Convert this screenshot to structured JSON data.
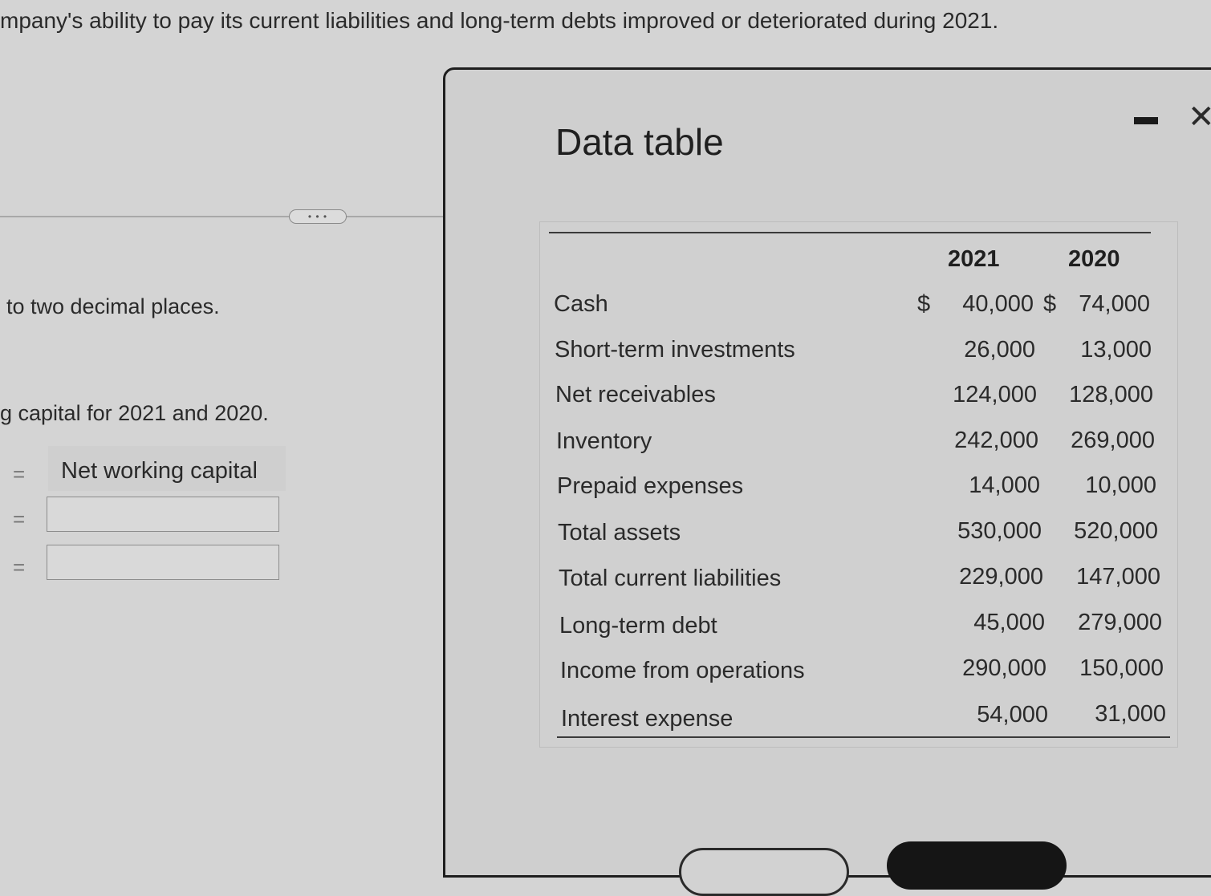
{
  "question": {
    "text": "mpany's ability to pay its current liabilities and long-term debts improved or deteriorated during 2021."
  },
  "more_button": {
    "label": "• • •"
  },
  "instructions": {
    "rounding": "to two decimal places.",
    "compute": "g capital for 2021 and 2020."
  },
  "formula": {
    "equals": "=",
    "result_label": "Net working capital"
  },
  "modal": {
    "title": "Data table",
    "minimize_icon": "minimize-icon",
    "close_icon": "close-icon",
    "close_glyph": "✕"
  },
  "data_table": {
    "columns": [
      "2021",
      "2020"
    ],
    "currency_symbol": "$",
    "rows": [
      {
        "label": "Cash",
        "v2021": "40,000",
        "v2020": "74,000"
      },
      {
        "label": "Short-term investments",
        "v2021": "26,000",
        "v2020": "13,000"
      },
      {
        "label": "Net receivables",
        "v2021": "124,000",
        "v2020": "128,000"
      },
      {
        "label": "Inventory",
        "v2021": "242,000",
        "v2020": "269,000"
      },
      {
        "label": "Prepaid expenses",
        "v2021": "14,000",
        "v2020": "10,000"
      },
      {
        "label": "Total assets",
        "v2021": "530,000",
        "v2020": "520,000"
      },
      {
        "label": "Total current liabilities",
        "v2021": "229,000",
        "v2020": "147,000"
      },
      {
        "label": "Long-term debt",
        "v2021": "45,000",
        "v2020": "279,000"
      },
      {
        "label": "Income from operations",
        "v2021": "290,000",
        "v2020": "150,000"
      },
      {
        "label": "Interest expense",
        "v2021": "54,000",
        "v2020": "31,000"
      }
    ]
  }
}
